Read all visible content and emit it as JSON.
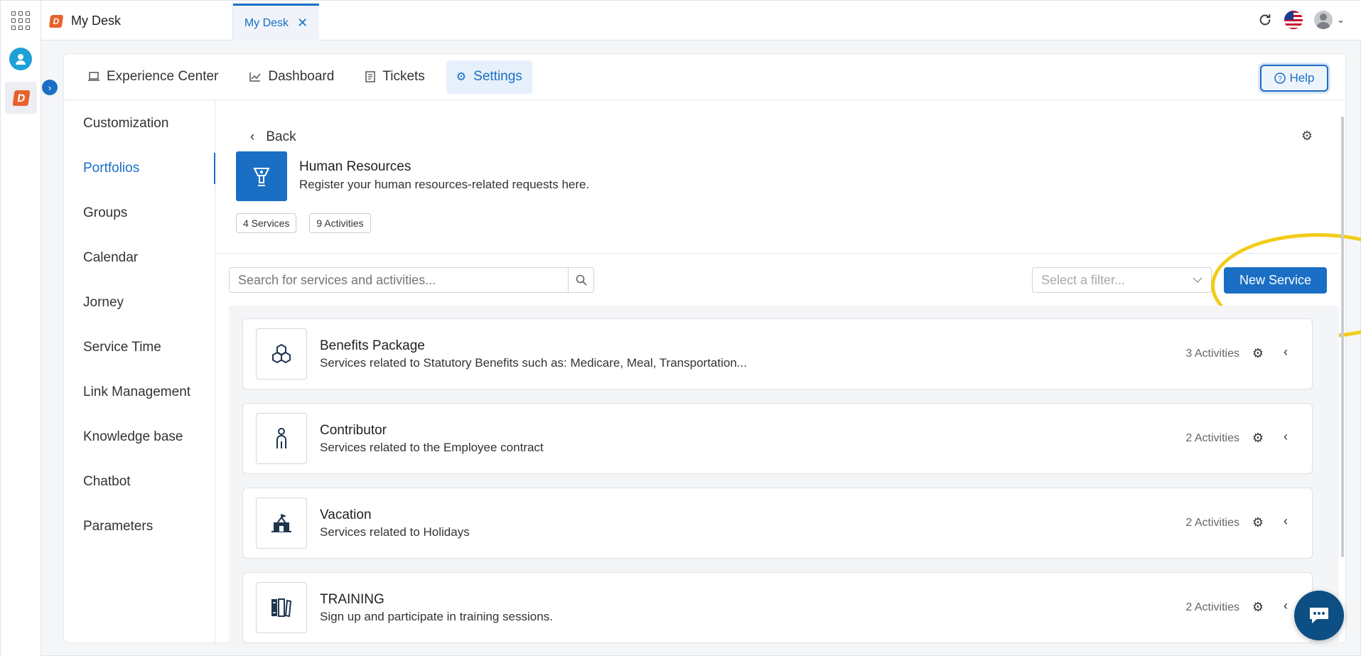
{
  "topbar": {
    "app_title": "My Desk",
    "tab_label": "My Desk"
  },
  "nav": {
    "items": [
      {
        "label": "Experience Center",
        "icon": "laptop-icon"
      },
      {
        "label": "Dashboard",
        "icon": "chart-icon"
      },
      {
        "label": "Tickets",
        "icon": "ticket-icon"
      },
      {
        "label": "Settings",
        "icon": "gear-icon",
        "active": true
      }
    ],
    "help_label": "Help"
  },
  "sidebar": {
    "items": [
      {
        "label": "Customization"
      },
      {
        "label": "Portfolios",
        "active": true
      },
      {
        "label": "Groups"
      },
      {
        "label": "Calendar"
      },
      {
        "label": "Jorney"
      },
      {
        "label": "Service Time"
      },
      {
        "label": "Link Management"
      },
      {
        "label": "Knowledge base"
      },
      {
        "label": "Chatbot"
      },
      {
        "label": "Parameters"
      }
    ]
  },
  "portfolio": {
    "back_label": "Back",
    "title": "Human Resources",
    "description": "Register your human resources-related requests here.",
    "services_chip": "4 Services",
    "activities_chip": "9 Activities"
  },
  "toolbar": {
    "search_placeholder": "Search for services and activities...",
    "filter_placeholder": "Select a filter...",
    "new_service_label": "New Service"
  },
  "services": [
    {
      "title": "Benefits Package",
      "description": "Services related to Statutory Benefits such as: Medicare, Meal, Transportation...",
      "activities": "3 Activities",
      "icon": "hexagons-icon"
    },
    {
      "title": "Contributor",
      "description": "Services related to the Employee contract",
      "activities": "2 Activities",
      "icon": "person-icon"
    },
    {
      "title": "Vacation",
      "description": "Services related to Holidays",
      "activities": "2 Activities",
      "icon": "beach-icon"
    },
    {
      "title": "TRAINING",
      "description": "Sign up and participate in training sessions.",
      "activities": "2 Activities",
      "icon": "books-icon"
    }
  ],
  "colors": {
    "accent": "#1a6fc4",
    "highlight": "#f2cc19",
    "brand": "#e8632b"
  }
}
